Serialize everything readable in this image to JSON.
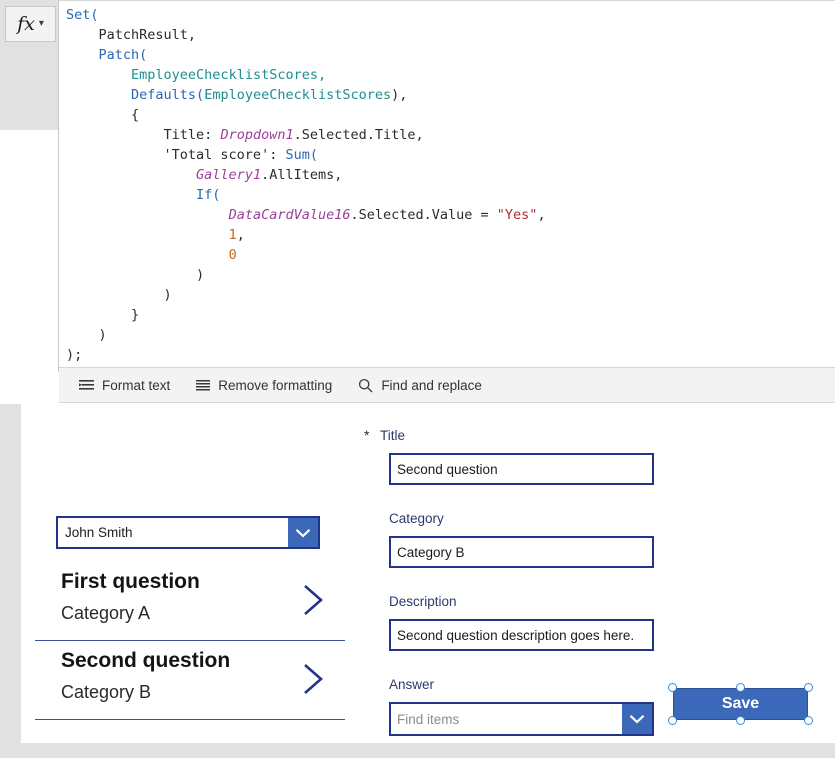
{
  "formula_bar": {
    "fx_label": "fx",
    "caret_icon": "chevron-down-icon",
    "code_lines": [
      [
        {
          "t": "Set(",
          "c": "fn"
        }
      ],
      [
        {
          "t": "    PatchResult,",
          "c": "plain"
        }
      ],
      [
        {
          "t": "    ",
          "c": "plain"
        },
        {
          "t": "Patch(",
          "c": "fn"
        }
      ],
      [
        {
          "t": "        ",
          "c": "plain"
        },
        {
          "t": "EmployeeChecklistScores,",
          "c": "src"
        }
      ],
      [
        {
          "t": "        ",
          "c": "plain"
        },
        {
          "t": "Defaults(",
          "c": "fn"
        },
        {
          "t": "EmployeeChecklistScores",
          "c": "src"
        },
        {
          "t": "),",
          "c": "plain"
        }
      ],
      [
        {
          "t": "        {",
          "c": "plain"
        }
      ],
      [
        {
          "t": "            Title: ",
          "c": "plain"
        },
        {
          "t": "Dropdown1",
          "c": "ctrl"
        },
        {
          "t": ".Selected.Title,",
          "c": "plain"
        }
      ],
      [
        {
          "t": "            'Total score': ",
          "c": "plain"
        },
        {
          "t": "Sum(",
          "c": "fn"
        }
      ],
      [
        {
          "t": "                ",
          "c": "plain"
        },
        {
          "t": "Gallery1",
          "c": "ctrl"
        },
        {
          "t": ".AllItems,",
          "c": "plain"
        }
      ],
      [
        {
          "t": "                ",
          "c": "plain"
        },
        {
          "t": "If(",
          "c": "fn"
        }
      ],
      [
        {
          "t": "                    ",
          "c": "plain"
        },
        {
          "t": "DataCardValue16",
          "c": "ctrl"
        },
        {
          "t": ".Selected.Value = ",
          "c": "plain"
        },
        {
          "t": "\"Yes\"",
          "c": "str"
        },
        {
          "t": ",",
          "c": "plain"
        }
      ],
      [
        {
          "t": "                    ",
          "c": "plain"
        },
        {
          "t": "1",
          "c": "num"
        },
        {
          "t": ",",
          "c": "plain"
        }
      ],
      [
        {
          "t": "                    ",
          "c": "plain"
        },
        {
          "t": "0",
          "c": "num"
        }
      ],
      [
        {
          "t": "                )",
          "c": "plain"
        }
      ],
      [
        {
          "t": "            )",
          "c": "plain"
        }
      ],
      [
        {
          "t": "        }",
          "c": "plain"
        }
      ],
      [
        {
          "t": "    )",
          "c": "plain"
        }
      ],
      [
        {
          "t": ");",
          "c": "plain"
        }
      ]
    ],
    "toolbar": [
      {
        "label": "Format text",
        "icon": "format-text-icon"
      },
      {
        "label": "Remove formatting",
        "icon": "remove-formatting-icon"
      },
      {
        "label": "Find and replace",
        "icon": "search-icon"
      }
    ]
  },
  "canvas": {
    "person_dropdown": {
      "value": "John Smith",
      "arrow_icon": "chevron-down-icon"
    },
    "gallery": {
      "chevron_icon": "chevron-right-icon",
      "items": [
        {
          "title": "First question",
          "subtitle": "Category A"
        },
        {
          "title": "Second question",
          "subtitle": "Category B"
        }
      ]
    },
    "form": {
      "fields": [
        {
          "label": "Title",
          "required": "*",
          "value": "Second question",
          "type": "text"
        },
        {
          "label": "Category",
          "required": "",
          "value": "Category B",
          "type": "text"
        },
        {
          "label": "Description",
          "required": "",
          "value": "Second question description goes here.",
          "type": "text"
        },
        {
          "label": "Answer",
          "required": "",
          "placeholder": "Find items",
          "type": "combobox",
          "arrow_icon": "chevron-down-icon"
        }
      ]
    },
    "save_button": {
      "label": "Save",
      "selected": true,
      "color": "#3b68b8"
    }
  },
  "colors": {
    "accent_blue": "#3b68b8",
    "border_navy": "#23348c",
    "label_navy": "#2b3a6b",
    "selection_handle": "#3b8ad8",
    "rail_gray": "#e1e1e1",
    "toolbar_gray": "#f3f3f3"
  }
}
